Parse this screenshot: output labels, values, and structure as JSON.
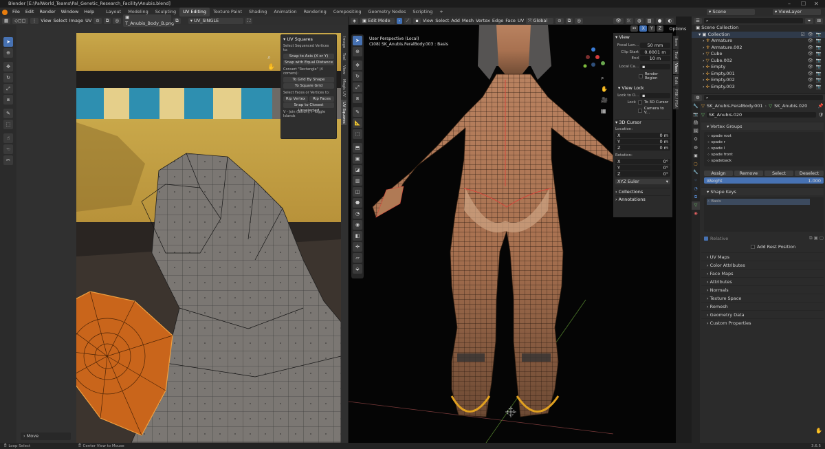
{
  "window": {
    "title": "Blender [E:\\PalWorld_Teams\\Pal_Genetic_Research_Facility\\Anubis.blend]",
    "controls": [
      "–",
      "☐",
      "✕"
    ]
  },
  "topmenu": [
    "File",
    "Edit",
    "Render",
    "Window",
    "Help"
  ],
  "workspaces": [
    {
      "label": "Layout",
      "active": false
    },
    {
      "label": "Modeling",
      "active": false
    },
    {
      "label": "Sculpting",
      "active": false
    },
    {
      "label": "UV Editing",
      "active": true
    },
    {
      "label": "Texture Paint",
      "active": false
    },
    {
      "label": "Shading",
      "active": false
    },
    {
      "label": "Animation",
      "active": false
    },
    {
      "label": "Rendering",
      "active": false
    },
    {
      "label": "Compositing",
      "active": false
    },
    {
      "label": "Geometry Nodes",
      "active": false
    },
    {
      "label": "Scripting",
      "active": false
    },
    {
      "label": "+",
      "active": false
    }
  ],
  "scene": {
    "label": "Scene",
    "viewlayer": "ViewLayer"
  },
  "uv_editor": {
    "menus": [
      "View",
      "Select",
      "Image",
      "UV"
    ],
    "image_name": "T_Anubis_Body_B.png",
    "uv_map": "UV_SINGLE",
    "tabs": [
      "Image",
      "Tool",
      "View",
      "Magic UV",
      "UV Squares"
    ],
    "uv_squares": {
      "title": "UV Squares",
      "sequenced_label": "Select Sequenced Vertices to:",
      "snap_axis": "Snap to Axis (X or Y)",
      "snap_equal": "Snap with Equal Distance",
      "convert_label": "Convert \"Rectangle\" (4 corners):",
      "grid_by_shape": "To Grid By Shape",
      "square_grid": "To Square Grid",
      "faces_label": "Select Faces or Vertices to:",
      "rip_vertex": "Rip Vertex",
      "rip_faces": "Rip Faces",
      "snap_closest": "Snap to Closest Unselected",
      "hint": "V - Join (Stitch), I -Toggle Islands"
    },
    "operator": "Move"
  },
  "viewport": {
    "mode": "Edit Mode",
    "menus": [
      "View",
      "Select",
      "Add",
      "Mesh",
      "Vertex",
      "Edge",
      "Face",
      "UV"
    ],
    "orientation": "Global",
    "options_label": "Options",
    "overlay_title": "User Perspective (Local)",
    "overlay_object": "(108) SK_Anubis.FeralBody.003 : Basis",
    "n_panel_tabs": [
      "Item",
      "Tool",
      "View",
      "Edit",
      "PSK / PSA"
    ],
    "view_panel": {
      "title": "View",
      "focal_label": "Focal Len...",
      "focal_value": "50 mm",
      "clip_start_label": "Clip Start",
      "clip_start_value": "0.0001 m",
      "end_label": "End",
      "end_value": "10 m",
      "local_camera_label": "Local Ca...",
      "render_region": "Render Region",
      "view_lock": "View Lock",
      "lock_to_object": "Lock to O...",
      "lock_label": "Lock",
      "to_3d_cursor": "To 3D Cursor",
      "camera_to_view": "Camera to V..."
    },
    "cursor_panel": {
      "title": "3D Cursor",
      "location_label": "Location:",
      "location": [
        {
          "axis": "X",
          "value": "0 m"
        },
        {
          "axis": "Y",
          "value": "0 m"
        },
        {
          "axis": "Z",
          "value": "0 m"
        }
      ],
      "rotation_label": "Rotation:",
      "rotation": [
        {
          "axis": "X",
          "value": "0°"
        },
        {
          "axis": "Y",
          "value": "0°"
        },
        {
          "axis": "Z",
          "value": "0°"
        }
      ],
      "rotation_mode": "XYZ Euler"
    },
    "collections_label": "Collections",
    "annotations_label": "Annotations"
  },
  "outliner": {
    "root": "Scene Collection",
    "collection": "Collection",
    "items": [
      "Armature",
      "Armature.002",
      "Cube",
      "Cube.002",
      "Empty",
      "Empty.001",
      "Empty.002",
      "Empty.003"
    ]
  },
  "properties": {
    "breadcrumb_object": "SK_Anubis.FeralBody.001",
    "breadcrumb_mesh": "SK_Anubis.020",
    "data_name": "SK_Anubis.020",
    "vertex_groups_title": "Vertex Groups",
    "vertex_groups": [
      "spade root",
      "spade r",
      "spade l",
      "spade front",
      "spadeback"
    ],
    "vg_buttons": [
      "Assign",
      "Remove",
      "Select",
      "Deselect"
    ],
    "weight_label": "Weight",
    "weight_value": "1.000",
    "shape_keys_title": "Shape Keys",
    "shape_keys": [
      "Basis"
    ],
    "relative_label": "Relative",
    "add_rest_label": "Add Rest Position",
    "sections": [
      "UV Maps",
      "Color Attributes",
      "Face Maps",
      "Attributes",
      "Normals",
      "Texture Space",
      "Remesh",
      "Geometry Data",
      "Custom Properties"
    ]
  },
  "statusbar": {
    "left": "Loop Select",
    "middle": "Center View to Mouse",
    "version": "3.6.5"
  }
}
